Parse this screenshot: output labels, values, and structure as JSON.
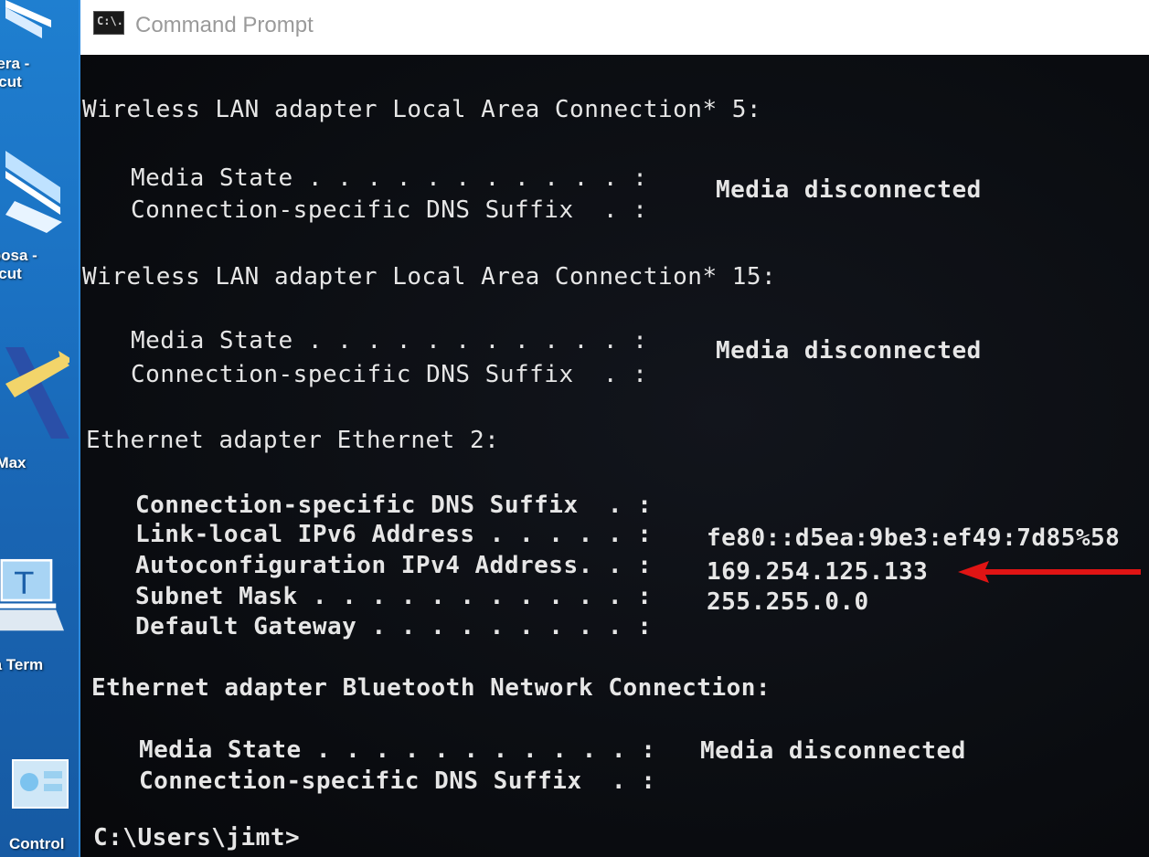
{
  "window": {
    "title": "Command Prompt",
    "icon_text": "C:\\."
  },
  "desktop": {
    "icons": [
      {
        "name": "madera-shortcut",
        "label_lines": [
          "dera -",
          "rtcut"
        ]
      },
      {
        "name": "mariposa-shortcut",
        "label_lines": [
          "iposa -",
          "rtcut"
        ]
      },
      {
        "name": "fullmax",
        "label_lines": [
          "llMax"
        ]
      },
      {
        "name": "tera-term",
        "label_lines": [
          "ra Term"
        ]
      },
      {
        "name": "control-panel",
        "label_lines": [
          "Control"
        ]
      }
    ]
  },
  "console": {
    "adapters": [
      {
        "header": "Wireless LAN adapter Local Area Connection* 5:",
        "rows": [
          {
            "label": "Media State . . . . . . . . . . . :",
            "value": "Media disconnected"
          },
          {
            "label": "Connection-specific DNS Suffix  . :",
            "value": ""
          }
        ]
      },
      {
        "header": "Wireless LAN adapter Local Area Connection* 15:",
        "rows": [
          {
            "label": "Media State . . . . . . . . . . . :",
            "value": "Media disconnected"
          },
          {
            "label": "Connection-specific DNS Suffix  . :",
            "value": ""
          }
        ]
      },
      {
        "header": "Ethernet adapter Ethernet 2:",
        "rows": [
          {
            "label": "Connection-specific DNS Suffix  . :",
            "value": ""
          },
          {
            "label": "Link-local IPv6 Address . . . . . :",
            "value": "fe80::d5ea:9be3:ef49:7d85%58"
          },
          {
            "label": "Autoconfiguration IPv4 Address. . :",
            "value": "169.254.125.133"
          },
          {
            "label": "Subnet Mask . . . . . . . . . . . :",
            "value": "255.255.0.0"
          },
          {
            "label": "Default Gateway . . . . . . . . . :",
            "value": ""
          }
        ]
      },
      {
        "header": "Ethernet adapter Bluetooth Network Connection:",
        "rows": [
          {
            "label": "Media State . . . . . . . . . . . :",
            "value": "Media disconnected"
          },
          {
            "label": "Connection-specific DNS Suffix  . :",
            "value": ""
          }
        ]
      }
    ],
    "prompt": "C:\\Users\\jimt>"
  },
  "colors": {
    "console_text": "#e6e6e6",
    "annotation_arrow": "#e01414",
    "desktop_blue": "#1b71c2"
  }
}
